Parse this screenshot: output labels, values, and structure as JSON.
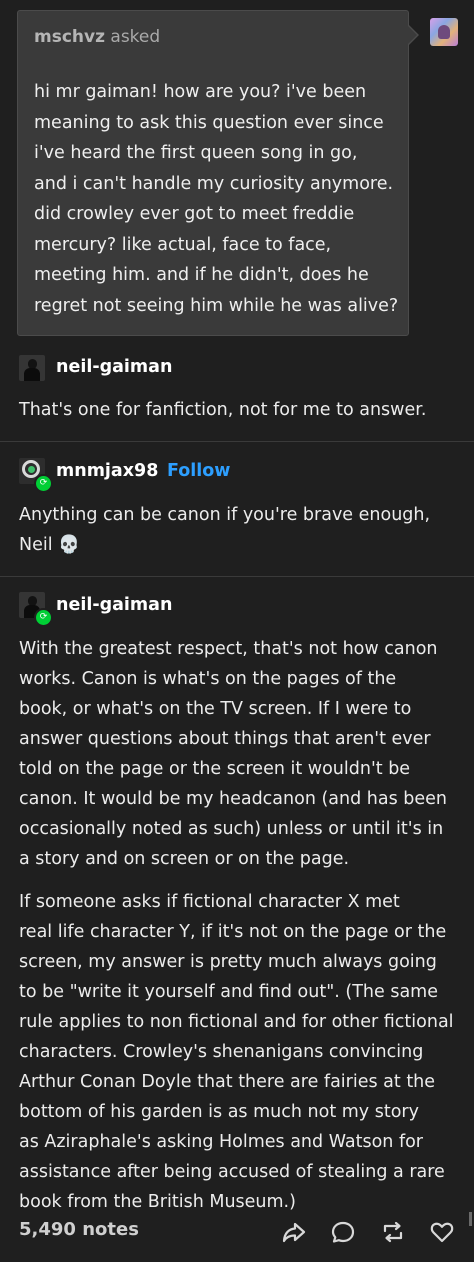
{
  "ask": {
    "asker": "mschvz",
    "asked_label": "asked",
    "lines": [
      "hi mr gaiman! how are you? i've been",
      "meaning to ask this question ever since",
      "i've heard the first queen song in go,",
      "and i can't handle my curiosity anymore.",
      "did crowley ever got to meet freddie",
      "mercury? like actual, face to face,",
      "meeting him. and if he didn't, does he",
      "regret not seeing him while he was alive?"
    ]
  },
  "answer": {
    "username": "neil-gaiman",
    "text": "That's one for fanfiction, not for me to answer."
  },
  "reblog1": {
    "username": "mnmjax98",
    "follow_label": "Follow",
    "lines": [
      "Anything can be canon if you're brave enough,",
      "Neil 💀"
    ]
  },
  "reblog2": {
    "username": "neil-gaiman",
    "para1": [
      "With the greatest respect, that's not how canon",
      "works. Canon is what's on the pages of the",
      "book, or what's on the TV screen. If I were to",
      "answer questions about things that aren't ever",
      "told on the page or the screen it wouldn't be",
      "canon. It would be my headcanon (and has been",
      "occasionally noted as such) unless or until it's in",
      "a story and on screen or on the page."
    ],
    "para2": [
      "If someone asks if fictional character X met",
      "real life character Y, if it's not on the page or the",
      "screen, my answer is pretty much always going",
      "to be \"write it yourself and find out\".  (The same",
      "rule applies to non fictional and for other fictional",
      "characters. Crowley's shenanigans convincing",
      "Arthur Conan Doyle that there are fairies at the",
      "bottom of his garden is as much not my story",
      "as Aziraphale's  asking Holmes and Watson for",
      "assistance after being accused of stealing a rare",
      "book from the British Museum.)"
    ]
  },
  "footer": {
    "notes": "5,490 notes",
    "icons": [
      "share-icon",
      "reply-icon",
      "reblog-icon",
      "like-icon"
    ]
  },
  "colors": {
    "background": "#1f1f1f",
    "ask_bubble": "#3a3a3a",
    "follow_blue": "#2d9fff",
    "reblog_green": "#00cf35"
  }
}
